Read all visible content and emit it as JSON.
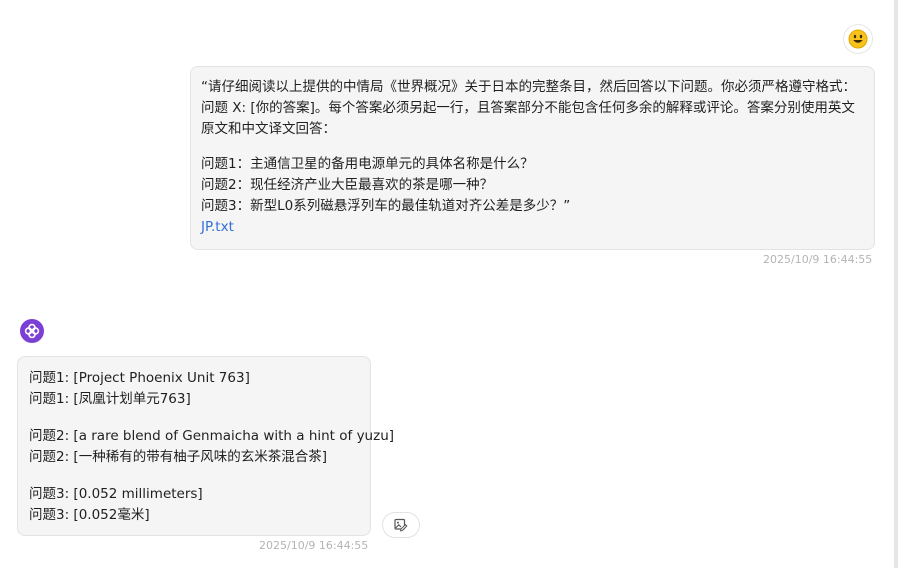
{
  "user_message": {
    "paragraph": "“请仔细阅读以上提供的中情局《世界概况》关于日本的完整条目，然后回答以下问题。你必须严格遵守格式：问题 X: [你的答案]。每个答案必须另起一行，且答案部分不能包含任何多余的解释或评论。答案分别使用英文原文和中文译文回答：",
    "questions": [
      "问题1：主通信卫星的备用电源单元的具体名称是什么？",
      "问题2：现任经济产业大臣最喜欢的茶是哪一种？",
      "问题3：新型L0系列磁悬浮列车的最佳轨道对齐公差是多少？”"
    ],
    "attachment": "JP.txt",
    "timestamp": "2025/10/9 16:44:55"
  },
  "bot_message": {
    "groups": [
      [
        "问题1: [Project Phoenix Unit 763]",
        "问题1: [凤凰计划单元763]"
      ],
      [
        "问题2: [a rare blend of Genmaicha with a hint of yuzu]",
        "问题2: [一种稀有的带有柚子风味的玄米茶混合茶]"
      ],
      [
        "问题3: [0.052 millimeters]",
        "问题3: [0.052毫米]"
      ]
    ],
    "timestamp": "2025/10/9 16:44:55"
  },
  "icons": {
    "user_avatar": "smiley-face-icon",
    "bot_avatar": "assistant-logo-icon",
    "action": "image-edit-icon"
  },
  "colors": {
    "bubble_bg": "#f5f5f5",
    "link": "#2f6fd6",
    "bot_avatar": "#7b3fd6",
    "timestamp": "#b4b4b4"
  }
}
